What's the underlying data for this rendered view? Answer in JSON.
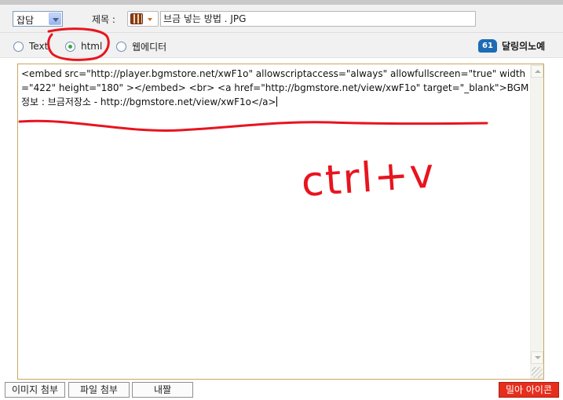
{
  "toolbar": {
    "category_value": "잡담",
    "title_label": "제목 :",
    "title_value": "브금 넣는 방법 . JPG"
  },
  "mode": {
    "options": [
      {
        "label": "Text",
        "selected": false
      },
      {
        "label": "html",
        "selected": true
      },
      {
        "label": "웹에디터",
        "selected": false
      }
    ],
    "logo_badge": "61",
    "logo_text": "달링의노예"
  },
  "editor": {
    "content": "<embed src=\"http://player.bgmstore.net/xwF1o\" allowscriptaccess=\"always\" allowfullscreen=\"true\" width=\"422\" height=\"180\" ></embed> <br> <a href=\"http://bgmstore.net/view/xwF1o\" target=\"_blank\">BGM정보 : 브금저장소 - http://bgmstore.net/view/xwF1o</a>"
  },
  "annotation": {
    "text": "ctrl+v",
    "color": "#e8141e"
  },
  "bottom": {
    "attach_image": "이미지 첨부",
    "attach_file": "파일 첨부",
    "my_files": "내짤",
    "emoticons": "밀아 아이콘"
  }
}
